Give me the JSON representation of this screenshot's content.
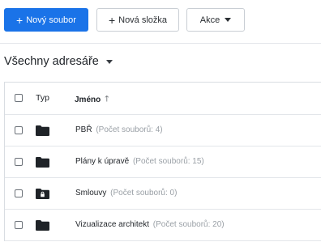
{
  "toolbar": {
    "new_file_label": "Nový soubor",
    "new_folder_label": "Nová složka",
    "actions_label": "Akce",
    "accent": "#1a73e8"
  },
  "section": {
    "title": "Všechny adresáře"
  },
  "table": {
    "columns": {
      "type": "Typ",
      "name": "Jméno"
    },
    "rows": [
      {
        "name": "PBŘ",
        "count": "(Počet souborů: 4)",
        "icon": "folder-icon"
      },
      {
        "name": "Plány k úpravě",
        "count": "(Počet souborů: 15)",
        "icon": "folder-icon"
      },
      {
        "name": "Smlouvy",
        "count": "(Počet souborů: 0)",
        "icon": "locked-folder-icon"
      },
      {
        "name": "Vizualizace architekt",
        "count": "(Počet souborů: 20)",
        "icon": "folder-icon"
      }
    ]
  }
}
